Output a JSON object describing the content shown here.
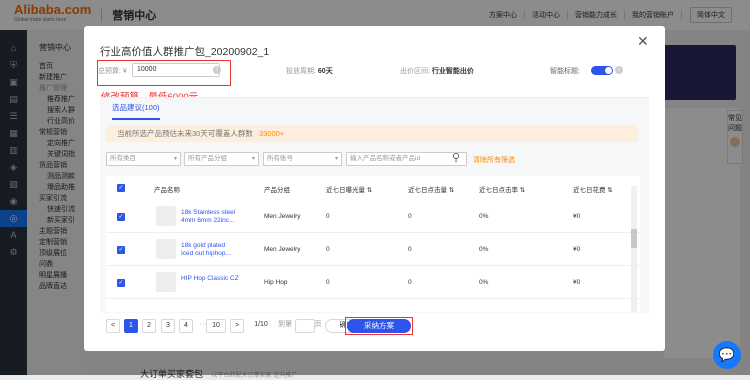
{
  "header": {
    "logo": "Alibaba.com",
    "tagline": "Global trade starts here",
    "title": "营销中心",
    "nav": [
      "方案中心",
      "活动中心",
      "营销能力成长",
      "我的营销账户"
    ],
    "language": "简体中文"
  },
  "sidebar": {
    "icons": [
      "home-icon",
      "shield-icon",
      "cart-icon",
      "doc-icon",
      "list-icon",
      "grid-icon",
      "store-icon",
      "tag-icon",
      "chart-icon",
      "user-icon",
      "coin-icon",
      "a-icon",
      "settings-icon"
    ],
    "title": "营销中心",
    "items": [
      {
        "label": "首页",
        "type": "item"
      },
      {
        "label": "新建推广",
        "type": "item"
      },
      {
        "label": "推广管理",
        "type": "group"
      },
      {
        "label": "推荐推广",
        "type": "sub"
      },
      {
        "label": "搜索人群",
        "type": "sub"
      },
      {
        "label": "行业高价",
        "type": "sub"
      },
      {
        "label": "常规营销",
        "type": "item"
      },
      {
        "label": "定向推广",
        "type": "sub"
      },
      {
        "label": "关键词指",
        "type": "sub"
      },
      {
        "label": "货品营销",
        "type": "item"
      },
      {
        "label": "测品测款",
        "type": "sub"
      },
      {
        "label": "爆品助推",
        "type": "sub"
      },
      {
        "label": "买家引流",
        "type": "item"
      },
      {
        "label": "快速引流",
        "type": "sub"
      },
      {
        "label": "新买家引",
        "type": "sub"
      },
      {
        "label": "主题营销",
        "type": "item"
      },
      {
        "label": "定制营销",
        "type": "item"
      },
      {
        "label": "顶级展位",
        "type": "item"
      },
      {
        "label": "问鼎",
        "type": "item"
      },
      {
        "label": "明星展播",
        "type": "item"
      },
      {
        "label": "品牌直达",
        "type": "item"
      }
    ]
  },
  "background": {
    "help_label": "常见问题",
    "bottom_title": "大订单买家套包",
    "bottom_sub": "以平台匹配大订单买家 定向推广"
  },
  "modal": {
    "title": "行业高价值人群推广包_20200902_1",
    "close_glyph": "✕",
    "budget_label": "总预算: ¥",
    "budget_value": "10000",
    "period_label": "投放周期:",
    "period_value": "60天",
    "bid_label": "出价区间:",
    "bid_value": "行业智能出价",
    "smart_label": "智能标题:",
    "smart_enabled": true,
    "budget_warning": "修改预算，最低6000元",
    "tab_label": "选品建议(100)",
    "notice_text": "当前所选产品预估未来30天可覆盖人群数",
    "notice_value": "33000+",
    "filters": {
      "category": "所有类目",
      "product_group": "所有产品分组",
      "account": "所有账号",
      "search_placeholder": "输入产品名称或者产品id",
      "reset": "清除所有筛选"
    },
    "table": {
      "headers": [
        "产品名称",
        "产品分组",
        "近七日曝光量 ⇅",
        "近七日点击量 ⇅",
        "近七日点击率 ⇅",
        "近七日花费 ⇅"
      ],
      "rows": [
        {
          "name_line1": "18k Stainless steel",
          "name_line2": "4mm 6mm 22inc...",
          "group": "Men Jewelry",
          "impressions": "0",
          "clicks": "0",
          "ctr": "0%",
          "cost": "¥0"
        },
        {
          "name_line1": "18k gold plated",
          "name_line2": "Iced out hiphop...",
          "group": "Men Jewelry",
          "impressions": "0",
          "clicks": "0",
          "ctr": "0%",
          "cost": "¥0"
        },
        {
          "name_line1": "HIP Hop Classic CZ",
          "name_line2": "",
          "group": "Hip Hop",
          "impressions": "0",
          "clicks": "0",
          "ctr": "0%",
          "cost": "¥0"
        }
      ]
    },
    "pagination": {
      "prev": "<",
      "pages": [
        "1",
        "2",
        "3",
        "4"
      ],
      "ellipsis": "···",
      "last": "10",
      "next": ">",
      "summary": "1/10",
      "goto_label": "到第",
      "goto_suffix": "页",
      "confirm": "确定"
    },
    "purchase": "采纳方案"
  },
  "colors": {
    "accent": "#2f54eb",
    "warning": "#ee3333",
    "orange": "#ff8a00",
    "sidebar_dark": "#2b3441"
  }
}
